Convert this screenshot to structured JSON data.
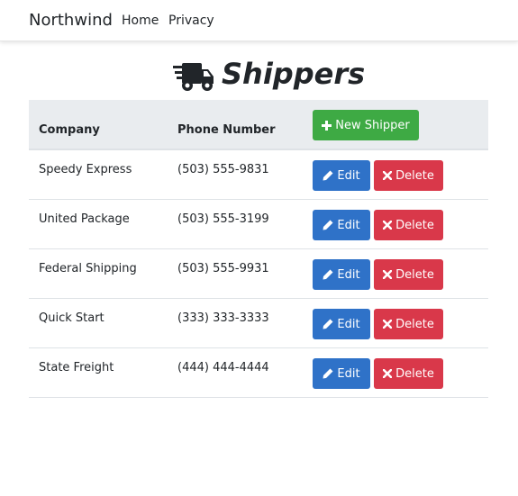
{
  "nav": {
    "brand": "Northwind",
    "links": [
      "Home",
      "Privacy"
    ]
  },
  "page": {
    "title": "Shippers",
    "title_icon": "truck-fast-icon"
  },
  "table": {
    "columns": [
      "Company",
      "Phone Number"
    ],
    "new_button": "New Shipper",
    "edit_label": "Edit",
    "delete_label": "Delete",
    "rows": [
      {
        "company": "Speedy Express",
        "phone": "(503) 555-9831"
      },
      {
        "company": "United Package",
        "phone": "(503) 555-3199"
      },
      {
        "company": "Federal Shipping",
        "phone": "(503) 555-9931"
      },
      {
        "company": "Quick Start",
        "phone": "(333) 333-3333"
      },
      {
        "company": "State Freight",
        "phone": "(444) 444-4444"
      }
    ]
  },
  "colors": {
    "new_button": "#3eaa44",
    "edit_button": "#2f72c8",
    "delete_button": "#d9384a",
    "header_bg": "#e9ecef"
  }
}
